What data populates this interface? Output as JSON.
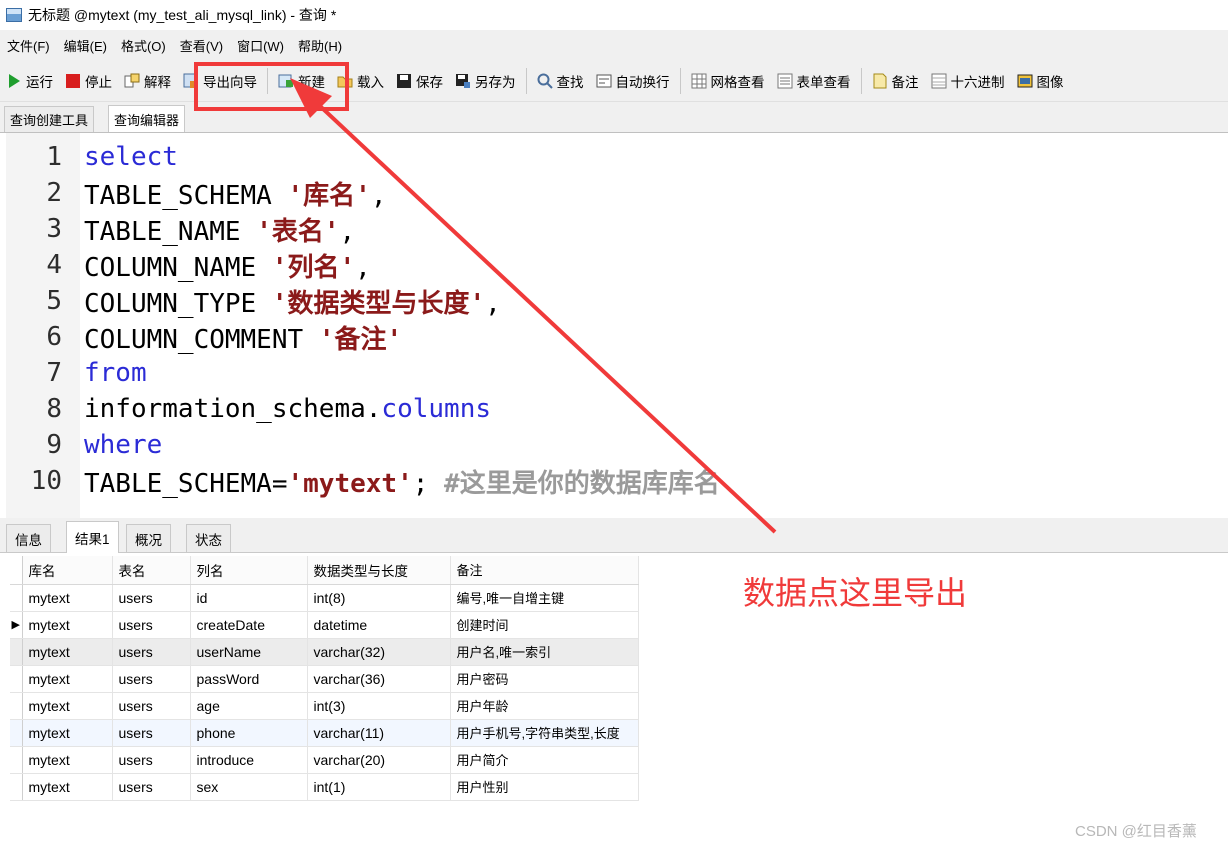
{
  "window": {
    "title": "无标题 @mytext (my_test_ali_mysql_link) - 查询 *"
  },
  "menu": [
    "文件(F)",
    "编辑(E)",
    "格式(O)",
    "查看(V)",
    "窗口(W)",
    "帮助(H)"
  ],
  "toolbar": {
    "run": "运行",
    "stop": "停止",
    "explain": "解释",
    "export_wizard": "导出向导",
    "new": "新建",
    "load": "载入",
    "save": "保存",
    "save_as": "另存为",
    "find": "查找",
    "word_wrap": "自动换行",
    "grid_view": "网格查看",
    "form_view": "表单查看",
    "memo": "备注",
    "hex": "十六进制",
    "image": "图像"
  },
  "editor_tabs": [
    "查询创建工具",
    "查询编辑器"
  ],
  "code": {
    "l1": "select",
    "l2a": "TABLE_SCHEMA ",
    "l2b": "'库名'",
    "l2c": ",",
    "l3a": "TABLE_NAME ",
    "l3b": "'表名'",
    "l3c": ",",
    "l4a": "COLUMN_NAME ",
    "l4b": "'列名'",
    "l4c": ",",
    "l5a": "COLUMN_TYPE ",
    "l5b": "'数据类型与长度'",
    "l5c": ",",
    "l6a": "COLUMN_COMMENT ",
    "l6b": "'备注'",
    "l7": "from",
    "l8a": "information_schema.",
    "l8b": "columns",
    "l9": "where",
    "l10a": "TABLE_SCHEMA=",
    "l10b": "'mytext'",
    "l10c": "; ",
    "l10d": "#这里是你的数据库库名"
  },
  "line_numbers": [
    "1",
    "2",
    "3",
    "4",
    "5",
    "6",
    "7",
    "8",
    "9",
    "10"
  ],
  "result_tabs": [
    "信息",
    "结果1",
    "概况",
    "状态"
  ],
  "grid": {
    "headers": [
      "库名",
      "表名",
      "列名",
      "数据类型与长度",
      "备注"
    ],
    "rows": [
      [
        "mytext",
        "users",
        "id",
        "int(8)",
        "编号,唯一自增主键"
      ],
      [
        "mytext",
        "users",
        "createDate",
        "datetime",
        "创建时间"
      ],
      [
        "mytext",
        "users",
        "userName",
        "varchar(32)",
        "用户名,唯一索引"
      ],
      [
        "mytext",
        "users",
        "passWord",
        "varchar(36)",
        "用户密码"
      ],
      [
        "mytext",
        "users",
        "age",
        "int(3)",
        "用户年龄"
      ],
      [
        "mytext",
        "users",
        "phone",
        "varchar(11)",
        "用户手机号,字符串类型,长度"
      ],
      [
        "mytext",
        "users",
        "introduce",
        "varchar(20)",
        "用户简介"
      ],
      [
        "mytext",
        "users",
        "sex",
        "int(1)",
        "用户性别"
      ]
    ]
  },
  "annotation": {
    "text": "数据点这里导出",
    "color": "#f03a3a"
  },
  "watermark": "CSDN @红目香薰"
}
